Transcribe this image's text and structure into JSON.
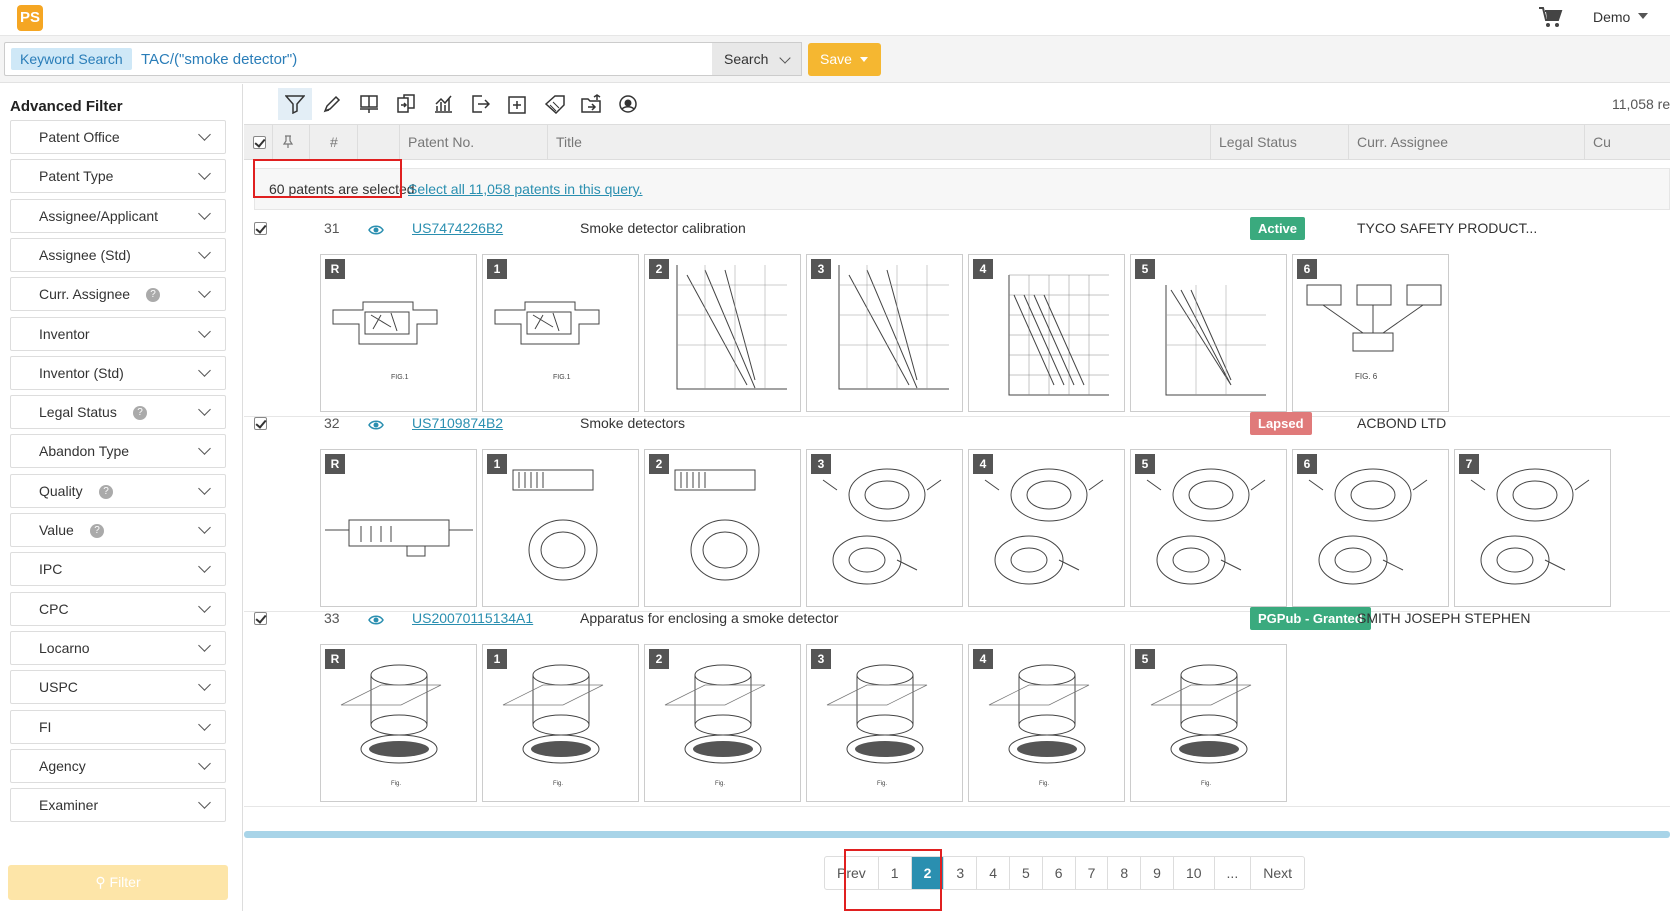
{
  "app": {
    "logo_text": "PS",
    "cart_icon": "cart-icon",
    "user": "Demo"
  },
  "search": {
    "label": "Keyword Search",
    "query": "TAC/(\"smoke detector\")",
    "search_label": "Search",
    "save_label": "Save"
  },
  "sidebar": {
    "title": "Advanced Filter",
    "filters": [
      {
        "label": "Patent Office",
        "help": false
      },
      {
        "label": "Patent Type",
        "help": false
      },
      {
        "label": "Assignee/Applicant",
        "help": false
      },
      {
        "label": "Assignee (Std)",
        "help": false
      },
      {
        "label": "Curr. Assignee",
        "help": true
      },
      {
        "label": "Inventor",
        "help": false
      },
      {
        "label": "Inventor (Std)",
        "help": false
      },
      {
        "label": "Legal Status",
        "help": true
      },
      {
        "label": "Abandon Type",
        "help": false
      },
      {
        "label": "Quality",
        "help": true
      },
      {
        "label": "Value",
        "help": true
      },
      {
        "label": "IPC",
        "help": false
      },
      {
        "label": "CPC",
        "help": false
      },
      {
        "label": "Locarno",
        "help": false
      },
      {
        "label": "USPC",
        "help": false
      },
      {
        "label": "FI",
        "help": false
      },
      {
        "label": "Agency",
        "help": false
      },
      {
        "label": "Examiner",
        "help": false
      }
    ],
    "help_glyph": "?",
    "filter_button": "Filter"
  },
  "toolbar": {
    "icons": [
      "filter-icon",
      "highlight-icon",
      "presentation-icon",
      "compare-icon",
      "analytics-icon",
      "export-icon",
      "add-icon",
      "tag-icon",
      "folder-export-icon",
      "settings-icon"
    ],
    "count_text": "11,058 re"
  },
  "table": {
    "headers": {
      "num": "#",
      "patent_no": "Patent No.",
      "title": "Title",
      "legal_status": "Legal Status",
      "assignee": "Curr. Assignee",
      "more": "Cu"
    },
    "selection_text": "60 patents are selected",
    "select_all_link": "Select all 11,058 patents in this query.",
    "rows": [
      {
        "num": "31",
        "patent_no": "US7474226B2",
        "title": "Smoke detector calibration",
        "status": "Active",
        "status_color": "#3aaa7e",
        "assignee": "TYCO SAFETY PRODUCT...",
        "thumbs": [
          "R",
          "1",
          "2",
          "3",
          "4",
          "5",
          "6"
        ]
      },
      {
        "num": "32",
        "patent_no": "US7109874B2",
        "title": "Smoke detectors",
        "status": "Lapsed",
        "status_color": "#e07a7a",
        "assignee": "ACBOND LTD",
        "thumbs": [
          "R",
          "1",
          "2",
          "3",
          "4",
          "5",
          "6",
          "7"
        ]
      },
      {
        "num": "33",
        "patent_no": "US20070115134A1",
        "title": "Apparatus for enclosing a smoke detector",
        "status": "PGPub - Granted",
        "status_color": "#3aaa7e",
        "assignee": "SMITH JOSEPH STEPHEN",
        "thumbs": [
          "R",
          "1",
          "2",
          "3",
          "4",
          "5"
        ]
      }
    ]
  },
  "pagination": {
    "prev": "Prev",
    "pages": [
      "1",
      "2",
      "3",
      "4",
      "5",
      "6",
      "7",
      "8",
      "9",
      "10",
      "..."
    ],
    "current": "2",
    "next": "Next"
  }
}
